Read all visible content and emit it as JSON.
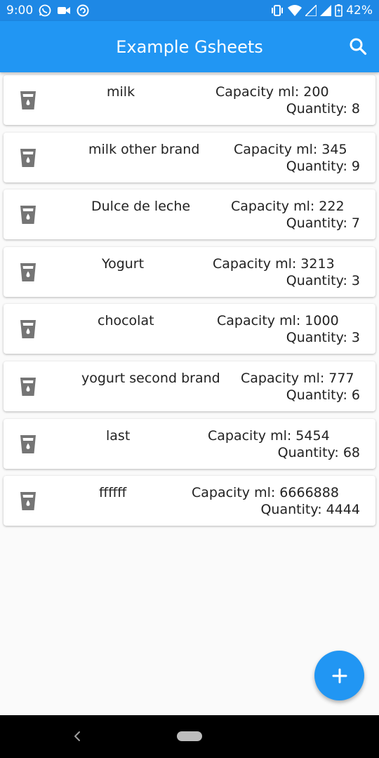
{
  "status_bar": {
    "time": "9:00",
    "battery": "42%",
    "left_icons": [
      "whatsapp-icon",
      "video-camera-icon",
      "sync-icon"
    ],
    "right_icons": [
      "vibrate-icon",
      "wifi-icon",
      "signal-icon",
      "signal-icon",
      "battery-icon"
    ]
  },
  "app_bar": {
    "title": "Example Gsheets",
    "search_icon": "search-icon",
    "color": "#2196f3"
  },
  "items": [
    {
      "name": "milk",
      "capacity": "Capacity ml: 200",
      "quantity": "Quantity:  8"
    },
    {
      "name": "milk other brand",
      "capacity": "Capacity ml: 345",
      "quantity": "Quantity:  9"
    },
    {
      "name": "Dulce de leche",
      "capacity": "Capacity ml: 222",
      "quantity": "Quantity:  7"
    },
    {
      "name": "Yogurt",
      "capacity": "Capacity ml: 3213",
      "quantity": "Quantity:  3"
    },
    {
      "name": "chocolat",
      "capacity": "Capacity ml: 1000",
      "quantity": "Quantity:  3"
    },
    {
      "name": "yogurt second brand",
      "capacity": "Capacity ml: 777",
      "quantity": "Quantity:  6"
    },
    {
      "name": "last",
      "capacity": "Capacity ml: 5454",
      "quantity": "Quantity:  68"
    },
    {
      "name": "ffffff",
      "capacity": "Capacity ml: 6666888",
      "quantity": "Quantity:  4444"
    }
  ],
  "item_icon": "water-glass-icon",
  "fab": {
    "icon": "plus-icon"
  },
  "nav_bar": {
    "back_icon": "back-icon",
    "home_icon": "home-pill-icon"
  }
}
